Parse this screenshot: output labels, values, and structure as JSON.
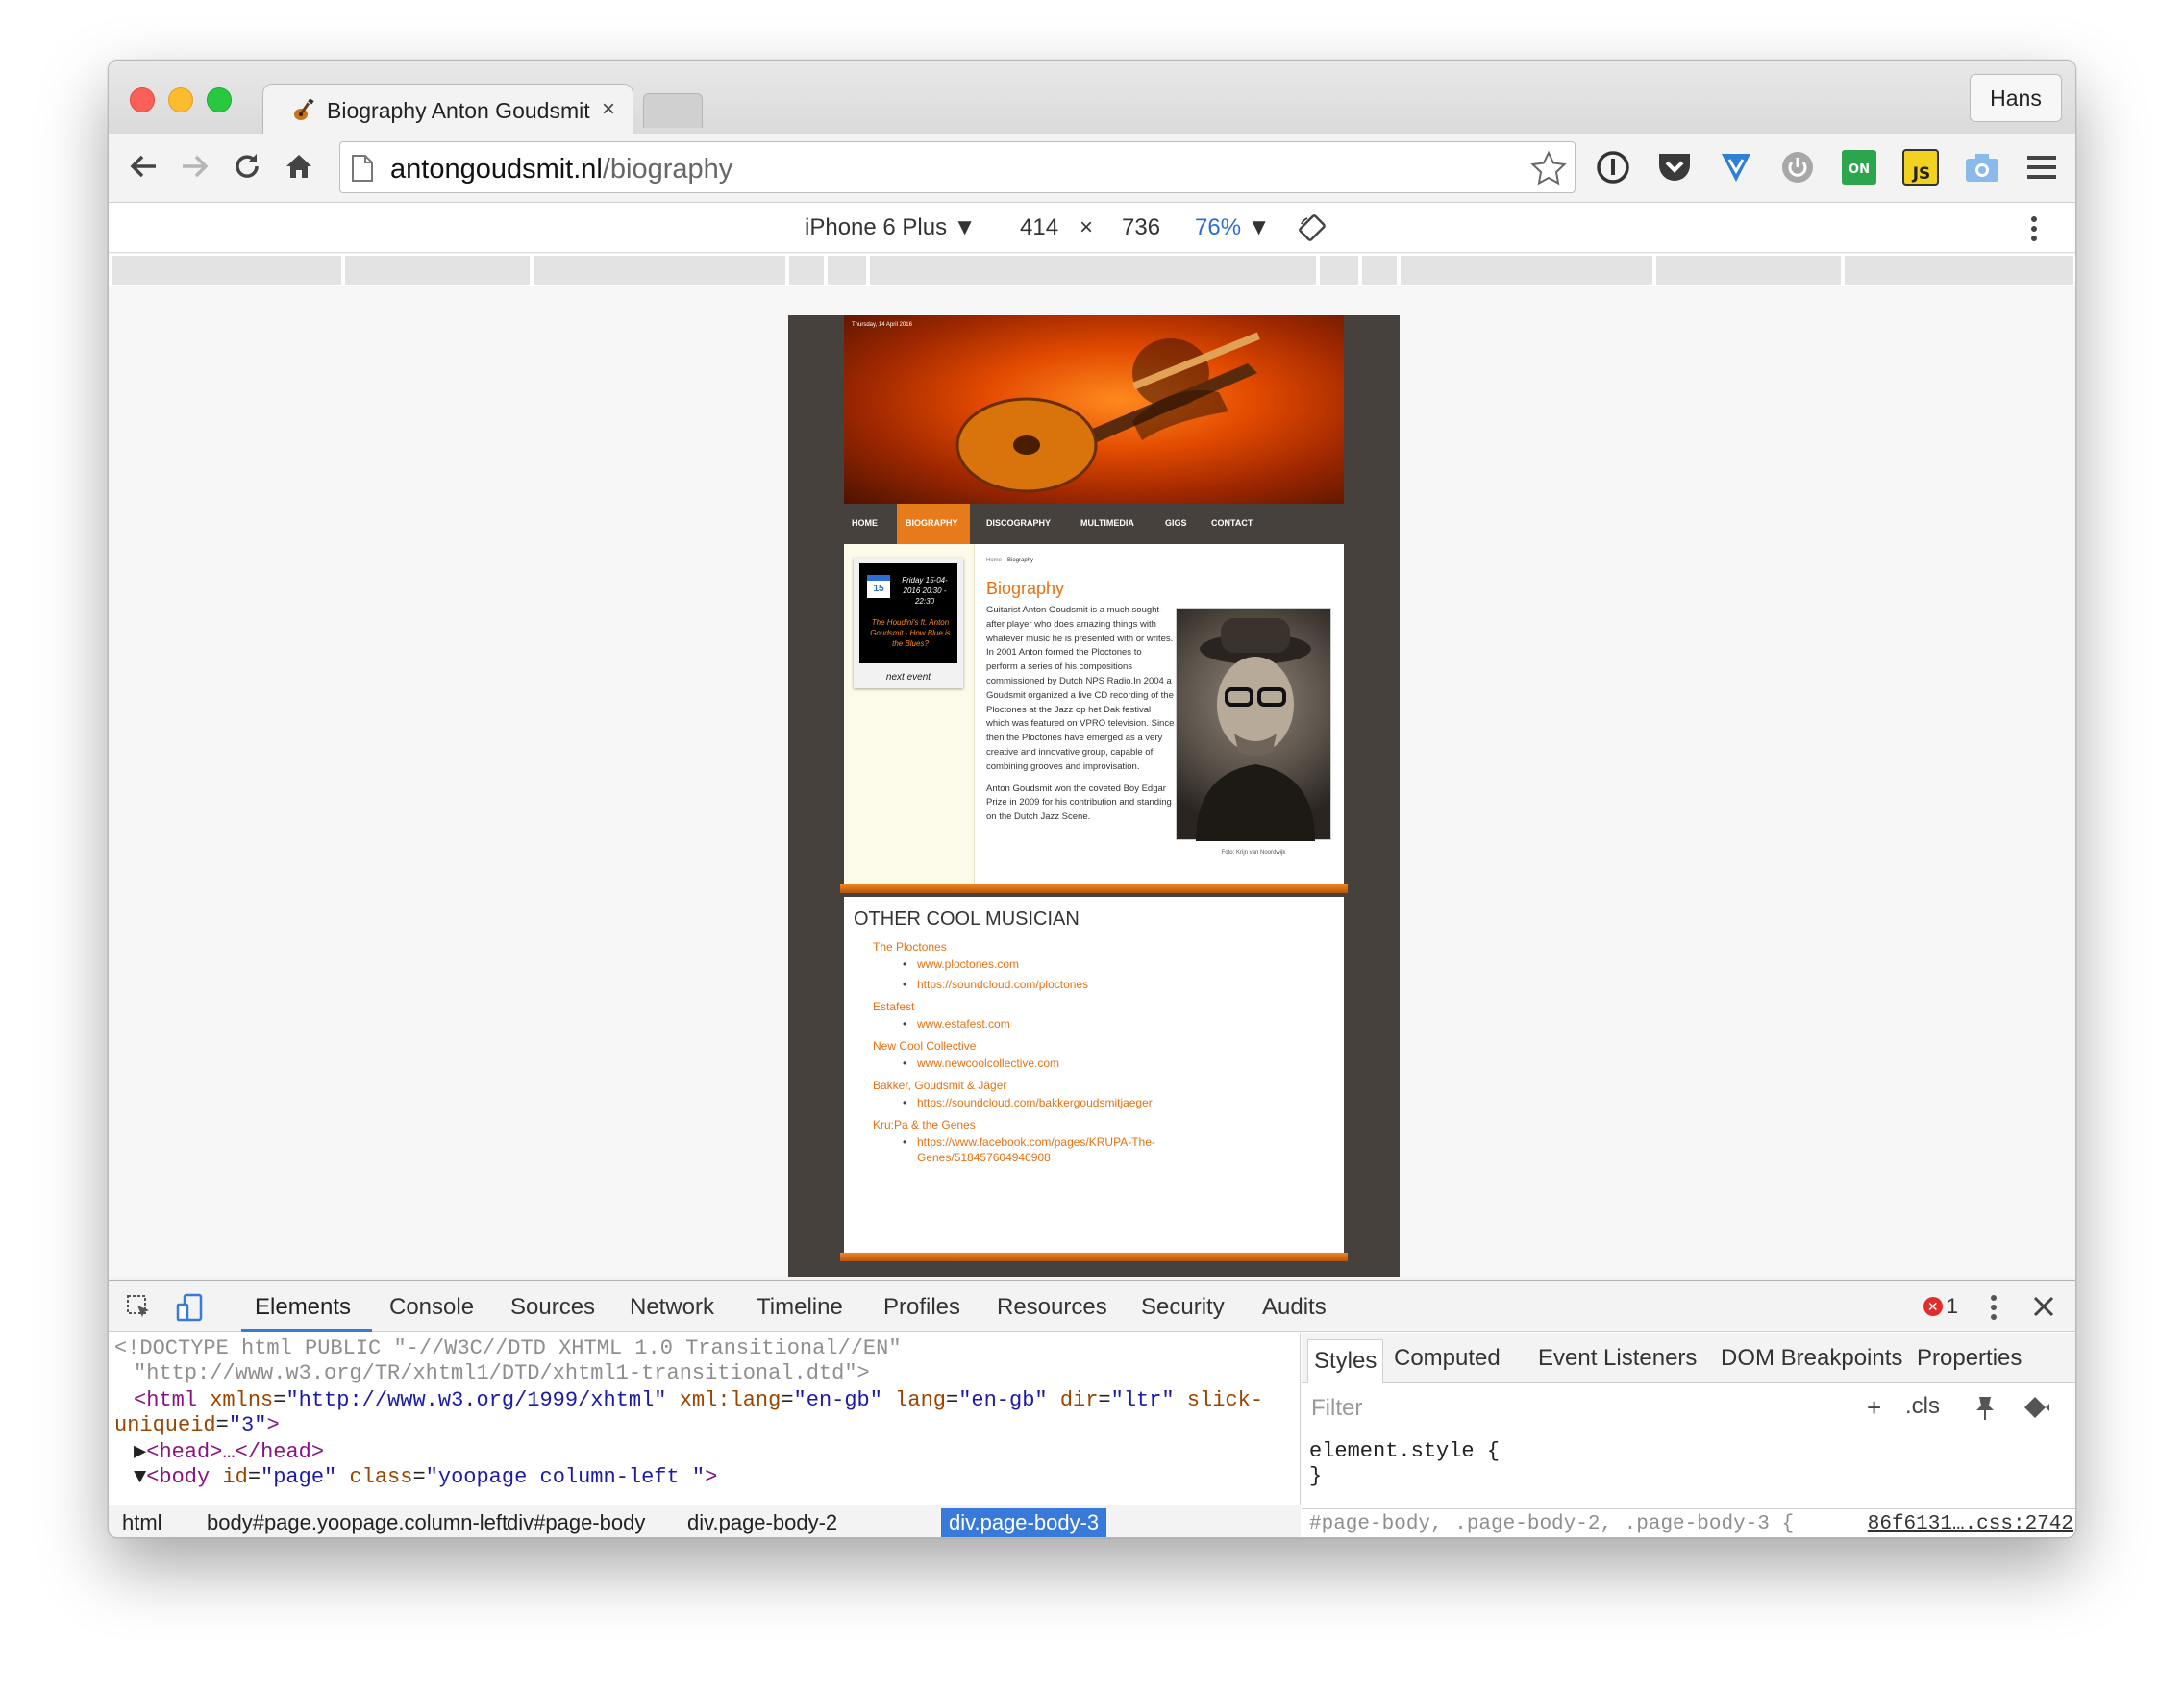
{
  "browser": {
    "tab_title": "Biography Anton Goudsmit",
    "tab_close": "×",
    "profile_name": "Hans",
    "url_domain": "antongoudsmit.nl",
    "url_path": "/biography"
  },
  "device_toolbar": {
    "device": "iPhone 6 Plus",
    "width": "414",
    "times": "×",
    "height": "736",
    "zoom": "76%"
  },
  "site": {
    "date": "Thursday, 14 April 2016",
    "nav": [
      "HOME",
      "BIOGRAPHY",
      "DISCOGRAPHY",
      "MULTIMEDIA",
      "GIGS",
      "CONTACT"
    ],
    "nav_active": "BIOGRAPHY",
    "event": {
      "cal_month": "APR",
      "cal_day": "15",
      "date": "Friday 15-04-2016 20:30 - 22:30",
      "title": "The Houdini's ft. Anton Goudsmit - How Blue is the Blues?",
      "caption": "next event"
    },
    "breadcrumb_home": "Home",
    "breadcrumb_current": "Biography",
    "heading": "Biography",
    "bio_p1": "Guitarist Anton Goudsmit is a much sought-after player who does amazing things with whatever music he is presented with or writes. In 2001 Anton formed the Ploctones to perform a series of his compositions commissioned by Dutch NPS Radio.In 2004 a Goudsmit organized a live CD recording of the Ploctones at the Jazz op het Dak festival which was featured on VPRO television. Since then the Ploctones have emerged as a very creative and innovative group, capable of combining grooves and improvisation.",
    "bio_p2": "Anton Goudsmit won the coveted Boy Edgar Prize in 2009 for his contribution and standing on the Dutch Jazz Scene.",
    "photo_caption": "Foto: Krijn van Noordwijk",
    "musicians_heading": "OTHER COOL MUSICIAN",
    "musicians": [
      {
        "name": "The Ploctones",
        "links": [
          "www.ploctones.com",
          "https://soundcloud.com/ploctones"
        ]
      },
      {
        "name": "Estafest",
        "links": [
          "www.estafest.com"
        ]
      },
      {
        "name": "New Cool Collective",
        "links": [
          "www.newcoolcollective.com"
        ]
      },
      {
        "name": "Bakker, Goudsmit & Jäger",
        "links": [
          "https://soundcloud.com/bakkergoudsmitjaeger"
        ]
      },
      {
        "name": "Kru:Pa & the Genes",
        "links": [
          "https://www.facebook.com/pages/KRUPA-The-Genes/518457604940908"
        ]
      }
    ]
  },
  "devtools": {
    "tabs": [
      "Elements",
      "Console",
      "Sources",
      "Network",
      "Timeline",
      "Profiles",
      "Resources",
      "Security",
      "Audits"
    ],
    "error_count": "1",
    "code": {
      "doctype1": "<!DOCTYPE html PUBLIC \"-//W3C//DTD XHTML 1.0 Transitional//EN\"",
      "doctype2": "\"http://www.w3.org/TR/xhtml1/DTD/xhtml1-transitional.dtd\">",
      "html_open": "<html",
      "attr_xmlns": "xmlns",
      "val_xmlns": "\"http://www.w3.org/1999/xhtml\"",
      "attr_xmllang": "xml:lang",
      "val_xmllang": "\"en-gb\"",
      "attr_lang": "lang",
      "val_lang": "\"en-gb\"",
      "attr_dir": "dir",
      "val_dir": "\"ltr\"",
      "attr_slick": "slick-",
      "attr_slick2": "uniqueid",
      "val_slick": "\"3\"",
      "head": "<head>…</head>",
      "body_open": "<body",
      "attr_id": "id",
      "val_id": "\"page\"",
      "attr_class": "class",
      "val_class": "\"yoopage column-left \""
    },
    "breadcrumbs": [
      "html",
      "body#page.yoopage.column-left",
      "div#page-body",
      "div.page-body-2",
      "div.page-body-3"
    ],
    "styles_tabs": [
      "Styles",
      "Computed",
      "Event Listeners",
      "DOM Breakpoints",
      "Properties"
    ],
    "filter_placeholder": "Filter",
    "cls_label": ".cls",
    "element_style": "element.style {",
    "close_brace": "}",
    "rule_selector": "#page-body, .page-body-2, .page-body-3 {",
    "rule_source": "86f6131….css:2742"
  }
}
